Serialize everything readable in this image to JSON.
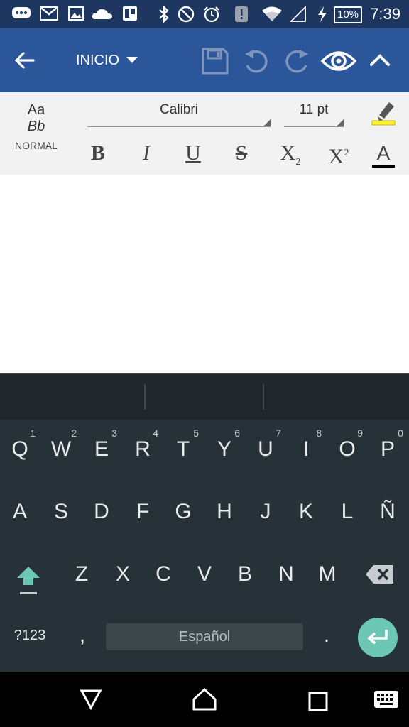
{
  "status_bar": {
    "time": "7:39",
    "battery": "10%",
    "icons": [
      "chat-icon",
      "gmail-icon",
      "gallery-icon",
      "onedrive-icon",
      "trello-icon",
      "bluetooth-icon",
      "do-not-disturb-icon",
      "alarm-icon",
      "alert-icon",
      "wifi-icon",
      "signal-icon",
      "charging-icon"
    ]
  },
  "toolbar": {
    "menu_label": "INICIO",
    "icons": [
      "back-arrow-icon",
      "dropdown-caret-icon",
      "save-icon",
      "undo-icon",
      "redo-icon",
      "eye-icon",
      "chevron-up-icon"
    ]
  },
  "ribbon": {
    "styles_preview_line1": "Aa",
    "styles_preview_line2": "Bb",
    "style_name": "NORMAL",
    "font_name": "Calibri",
    "font_size": "11 pt",
    "highlight_color": "#ffef3a",
    "font_color": "#000000",
    "format_buttons": {
      "bold": "B",
      "italic": "I",
      "underline": "U",
      "strike": "S",
      "subscript_base": "X",
      "subscript_mark": "2",
      "superscript_base": "X",
      "superscript_mark": "2",
      "font_color": "A"
    }
  },
  "keyboard": {
    "row1": [
      {
        "k": "Q",
        "h": "1"
      },
      {
        "k": "W",
        "h": "2"
      },
      {
        "k": "E",
        "h": "3"
      },
      {
        "k": "R",
        "h": "4"
      },
      {
        "k": "T",
        "h": "5"
      },
      {
        "k": "Y",
        "h": "6"
      },
      {
        "k": "U",
        "h": "7"
      },
      {
        "k": "I",
        "h": "8"
      },
      {
        "k": "O",
        "h": "9"
      },
      {
        "k": "P",
        "h": "0"
      }
    ],
    "row2": [
      "A",
      "S",
      "D",
      "F",
      "G",
      "H",
      "J",
      "K",
      "L",
      "Ñ"
    ],
    "row3": [
      "Z",
      "X",
      "C",
      "V",
      "B",
      "N",
      "M"
    ],
    "symbols_key": "?123",
    "comma_key": ",",
    "space_label": "Español",
    "period_key": ".",
    "accent_color": "#6cc8b5"
  },
  "nav_bar": {
    "icons": [
      "back-triangle-icon",
      "home-icon",
      "recents-icon",
      "keyboard-icon"
    ]
  }
}
